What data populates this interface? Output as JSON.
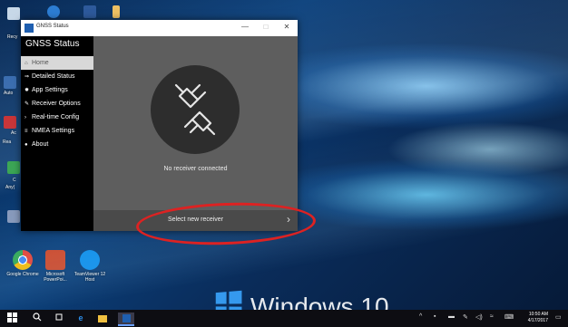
{
  "window": {
    "title": "GNSS Status",
    "controls": {
      "minimize": "—",
      "maximize": "□",
      "close": "✕"
    }
  },
  "sidebar": {
    "header": "GNSS Status",
    "items": [
      {
        "icon": "home-icon",
        "glyph": "⌂",
        "label": "Home",
        "active": true
      },
      {
        "icon": "arrow-icon",
        "glyph": "⇒",
        "label": "Detailed Status"
      },
      {
        "icon": "gear-icon",
        "glyph": "✹",
        "label": "App Settings"
      },
      {
        "icon": "wrench-icon",
        "glyph": "✎",
        "label": "Receiver Options"
      },
      {
        "icon": "chevron-icon",
        "glyph": "›",
        "label": "Real-time Config"
      },
      {
        "icon": "list-icon",
        "glyph": "≡",
        "label": "NMEA Settings"
      },
      {
        "icon": "info-icon",
        "glyph": "●",
        "label": "About"
      }
    ]
  },
  "main": {
    "status_text": "No receiver connected",
    "select_button": "Select new receiver",
    "chevron": "›"
  },
  "desktop": {
    "icons": [
      {
        "name": "google-chrome-icon",
        "label": "Google Chrome",
        "color": "#e8b400"
      },
      {
        "name": "powerpoint-icon",
        "label": "Microsoft PowerPoi...",
        "color": "#d24726"
      },
      {
        "name": "teamviewer-icon",
        "label": "TeamViewer 12 Host",
        "color": "#0e8ee9"
      }
    ],
    "partial_labels": [
      "Recy",
      "Auto",
      "Rea",
      "Any(",
      "Ac",
      "C"
    ],
    "wallpaper_text": "Windows 10"
  },
  "taskbar": {
    "clock_time": "10:50 AM",
    "clock_date": "4/17/2017"
  },
  "colors": {
    "accent": "#1f5fb0",
    "annotation_ring": "#dd2222"
  }
}
